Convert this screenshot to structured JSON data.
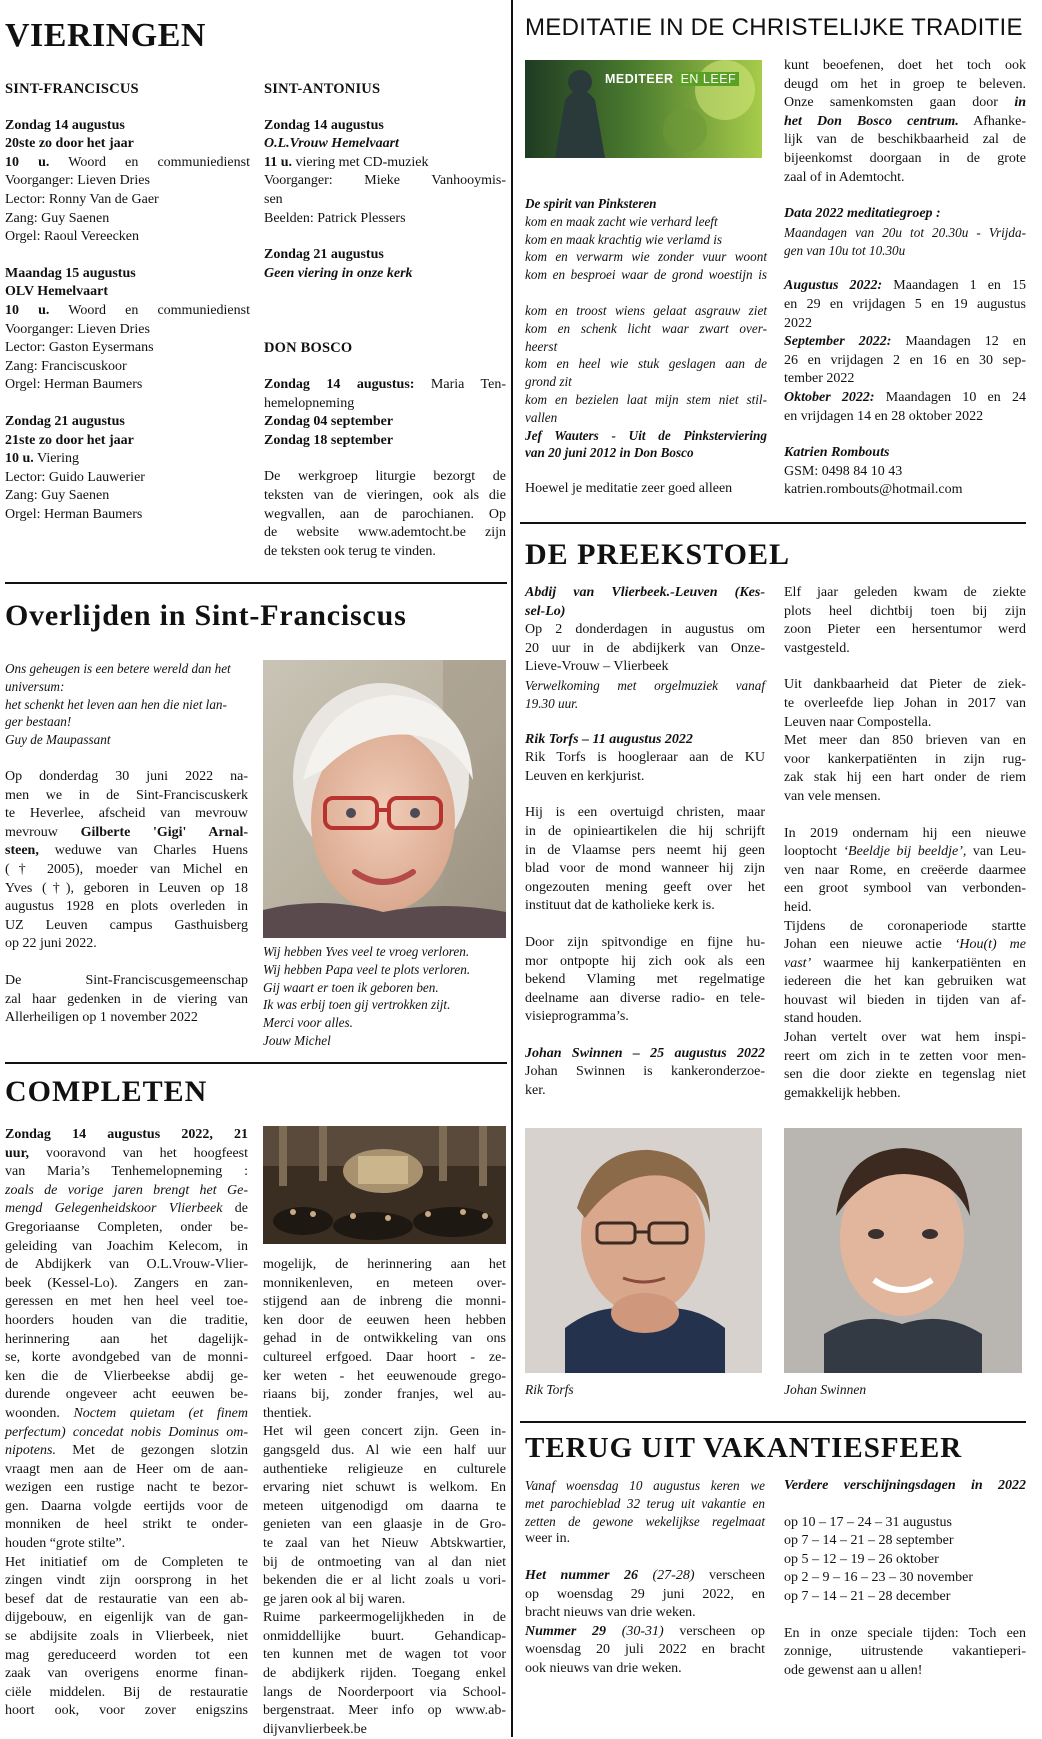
{
  "vieringen": {
    "title": "VIERINGEN",
    "franciscus": {
      "heading": "SINT-FRANCISCUS",
      "blocks": [
        {
          "l1": "Zondag 14 augustus",
          "l2": "20ste zo door het jaar",
          "l3b": "10 u.",
          "l3": " Woord en communiedienst",
          "lines": [
            "Voorganger: Lieven Dries",
            "Lector: Ronny Van de Gaer",
            "Zang: Guy Saenen",
            "Orgel: Raoul Vereecken"
          ]
        },
        {
          "l1": "Maandag 15 augustus",
          "l2": "OLV Hemelvaart",
          "l3b": "10 u.",
          "l3": " Woord en communiedienst",
          "lines": [
            "Voorganger: Lieven Dries",
            "Lector: Gaston Eysermans",
            "Zang: Franciscuskoor",
            "Orgel: Herman Baumers"
          ]
        },
        {
          "l1": "Zondag 21 augustus",
          "l2": "21ste zo door het jaar",
          "l3b": "10 u.",
          "l3": " Viering",
          "lines": [
            "Lector: Guido Lauwerier",
            "Zang: Guy Saenen",
            "Orgel: Herman Baumers"
          ]
        }
      ]
    },
    "antonius": {
      "heading": "SINT-ANTONIUS",
      "b1_l1": "Zondag 14 augustus",
      "b1_l2": "O.L.Vrouw Hemelvaart",
      "b1_l3b": "11 u.",
      "b1_l3": " viering met CD-muziek",
      "b1_voor": "Voorganger: Mieke Vanhooymis-",
      "b1_voor2": "sen",
      "b1_beeld": "Beelden: Patrick Plessers",
      "b2_l1": "Zondag 21 augustus",
      "b2_l2": "Geen viering in onze kerk"
    },
    "donbosco": {
      "heading": "DON BOSCO",
      "l1b": "Zondag 14 augustus:",
      "l1": " Maria Ten-",
      "l1b2": "hemelopneming",
      "l2": "Zondag 04 september",
      "l3": "Zondag 18 september",
      "text": [
        "De werkgroep liturgie bezorgt de",
        "teksten van de vieringen, ook als die",
        "wegvallen, aan de parochianen. Op",
        "de website www.ademtocht.be zijn",
        "de teksten ook terug te vinden."
      ]
    }
  },
  "overlijden": {
    "title": "Overlijden in Sint-Franciscus",
    "quote": [
      "Ons geheugen is een betere wereld dan het",
      "universum:",
      "het schenkt het leven aan hen die niet lan-",
      "ger bestaan!",
      "Guy de Maupassant"
    ],
    "body": [
      "Op donderdag 30 juni 2022 na-",
      "men we in de Sint-Franciscuskerk",
      "te Heverlee, afscheid van mevrouw",
      "mevrouw",
      "Gilberte 'Gigi' Arnal-",
      "steen,",
      "weduwe van Charles Huens",
      "(† 2005), moeder van Michel en",
      "Yves (†), geboren in Leuven op 18",
      "augustus 1928 en plots overleden in",
      "UZ Leuven campus Gasthuisberg",
      "op 22 juni 2022."
    ],
    "body2": [
      "De   Sint-Franciscusgemeenschap",
      "zal haar gedenken in de viering van",
      "Allerheiligen op 1 november 2022"
    ],
    "poem": [
      "Wij hebben Yves veel te vroeg verloren.",
      "Wij hebben Papa veel te plots verloren.",
      "Gij waart er toen ik geboren ben.",
      "Ik was erbij toen gij vertrokken zijt.",
      "Merci voor alles.",
      "Jouw Michel"
    ]
  },
  "completen": {
    "title": "COMPLETEN",
    "col1": [
      "Zondag 14 augustus 2022, 21",
      "uur,",
      "vooravond van het hoogfeest",
      "van Maria’s Tenhemelopneming :",
      "zoals de vorige jaren brengt het Ge-",
      "mengd Gelegenheidskoor Vlierbeek",
      "de",
      "Gregoriaanse Completen, onder be-",
      "geleiding van Joachim Kelecom, in",
      "de Abdijkerk van O.L.Vrouw-Vlier-",
      "beek (Kessel-Lo). Zangers en zan-",
      "geressen en met hen heel veel toe-",
      "hoorders houden van die traditie,",
      "herinnering aan het dagelijk-",
      "se, korte avondgebed van de monni-",
      "ken die de Vlierbeekse abdij ge-",
      "durende ongeveer acht eeuwen be-",
      "woonden.",
      "Noctem quietam (et finem",
      "perfectum) concedat nobis Dominus om-",
      "nipotens.",
      "Met de gezongen slotzin",
      "vraagt men aan de Heer om de aan-",
      "wezigen een rustige nacht te bezor-",
      "gen. Daarna volgde eertijds voor de",
      "monniken de heel strikt te onder-",
      "houden “grote stilte”.",
      "Het initiatief om de Completen te",
      "zingen vindt zijn oorsprong in het",
      "besef dat de restauratie van een ab-",
      "dijgebouw, en eigenlijk van de gan-",
      "se abdijsite zoals in Vlierbeek, niet",
      "mag gereduceerd worden tot een",
      "zaak van overigens enorme finan-",
      "ciële middelen. Bij de restauratie",
      "hoort ook, voor zover enigszins"
    ],
    "col2": [
      "mogelijk, de herinnering aan het",
      "monnikenleven, en meteen over-",
      "stijgend aan de inbreng die monni-",
      "ken door de eeuwen heen hebben",
      "gehad in de ontwikkeling van ons",
      "cultureel erfgoed. Daar hoort - ze-",
      "ker weten - het eeuwenoude grego-",
      "riaans bij, zonder franjes, wel au-",
      "thentiek.",
      "Het wil geen concert zijn. Geen in-",
      "gangsgeld dus. Al wie een half uur",
      "authentieke religieuze en culturele",
      "ervaring niet schuwt is welkom. En",
      "meteen uitgenodigd om daarna te",
      "genieten van een glaasje in de Gro-",
      "te zaal van het Nieuw Abtskwartier,",
      "bij de ontmoeting van al dan niet",
      "bekenden die er al licht zoals u vori-",
      "ge jaren ook al bij waren.",
      "Ruime parkeermogelijkheden in de",
      "onmiddellijke buurt. Gehandicap-",
      "ten kunnen met de wagen tot voor",
      "de abdijkerk rijden. Toegang enkel",
      "langs de Noorderpoort via School-",
      "bergenstraat. Meer info op www.ab-",
      "dijvanvlierbeek.be"
    ]
  },
  "meditatie": {
    "title": "MEDITATIE IN DE CHRISTELIJKE TRADITIE",
    "banner1": "MEDITEER",
    "banner2": "EN LEEF",
    "poem_title": "De spirit van Pinksteren",
    "poem": [
      "kom en maak zacht wie verhard leeft",
      "kom en maak krachtig wie verlamd is",
      "kom en verwarm wie zonder vuur woont",
      "kom en besproei waar de grond woestijn is",
      "",
      "kom en troost wiens gelaat asgrauw ziet",
      "kom en schenk licht waar zwart over-",
      "heerst",
      "kom en heel wie stuk geslagen aan de",
      "grond zit",
      "kom en bezielen laat mijn stem niet stil-",
      "vallen"
    ],
    "poem_src1": "Jef Wauters - Uit de Pinksterviering",
    "poem_src2": "van 20 juni 2012 in Don Bosco",
    "tail": "Hoewel je meditatie zeer goed alleen",
    "right": [
      "kunt beoefenen, doet het toch ook",
      "deugd om het in groep te beleven.",
      "Onze samenkomsten gaan door",
      "in",
      "het Don Bosco centrum.",
      "Afhanke-",
      "lijk van de beschikbaarheid zal de",
      "bijeenkomst doorgaan in de grote",
      "zaal of in Ademtocht."
    ],
    "data_title": "Data 2022 meditatiegroep :",
    "data_sub1": "Maandagen van 20u tot 20.30u - Vrijda-",
    "data_sub2": "gen van 10u tot 10.30u",
    "aug_b": "Augustus 2022:",
    "aug": [
      " Maandagen 1 en 15",
      "en 29 en vrijdagen 5 en 19 augustus",
      "2022"
    ],
    "sep_b": "September 2022:",
    "sep": [
      " Maandagen 12 en",
      "26 en vrijdagen 2 en 16 en 30 sep-",
      "tember 2022"
    ],
    "okt_b": "Oktober 2022:",
    "okt": [
      " Maandagen 10 en 24",
      "en vrijdagen 14 en 28 oktober 2022"
    ],
    "contact_name": "Katrien Rombouts",
    "contact_gsm": "GSM: 0498 84 10 43",
    "contact_mail": "katrien.rombouts@hotmail.com"
  },
  "preekstoel": {
    "title": "DE PREEKSTOEL",
    "left": {
      "h1a": "Abdij van Vlierbeek.-Leuven (Kes-",
      "h1b": "sel-Lo)",
      "p1": [
        "Op 2 donderdagen in augustus om",
        "20 uur in de abdijkerk van Onze-",
        "Lieve-Vrouw – Vlierbeek"
      ],
      "p1i": [
        "Verwelkoming met orgelmuziek vanaf",
        "19.30 uur."
      ],
      "h2": "Rik Torfs – 11 augustus 2022",
      "p2": [
        "Rik Torfs is hoogleraar aan de KU",
        "Leuven en kerkjurist."
      ],
      "p3": [
        "Hij is een overtuigd christen, maar",
        "in de opinieartikelen die hij schrijft",
        "in de Vlaamse pers neemt hij geen",
        "blad voor de mond wanneer hij zijn",
        "ongezouten mening geeft over het",
        "instituut dat de katholieke kerk is."
      ],
      "p4": [
        "Door zijn spitvondige en fijne hu-",
        "mor ontpopte hij zich ook als een",
        "bekend Vlaming met regelmatige",
        "deelname aan diverse radio- en tele-",
        "visieprogramma’s."
      ],
      "h3": "Johan Swinnen – 25 augustus 2022",
      "p5": [
        "Johan Swinnen is kankeronderzoe-",
        "ker."
      ]
    },
    "right": {
      "p1": [
        "Elf jaar geleden kwam de ziekte",
        "plots heel dichtbij toen bij zijn",
        "zoon Pieter een hersentumor werd",
        "vastgesteld."
      ],
      "p2": [
        "Uit dankbaarheid dat Pieter de ziek-",
        "te overleefde liep Johan in 2017 van",
        "Leuven naar Compostella.",
        "Met meer dan 850 brieven van en",
        "voor kankerpatiënten in zijn rug-",
        "zak stak hij een hart onder de riem",
        "van vele mensen."
      ],
      "p3": [
        "In 2019 ondernam hij een nieuwe",
        "looptocht",
        "‘Beeldje bij beeldje’,",
        "van Leu-",
        "ven naar Rome, en creëerde daarmee",
        "een groot symbool van verbonden-",
        "heid.",
        "Tijdens de coronaperiode startte",
        "Johan een nieuwe actie",
        "‘Hou(t) me",
        "vast’",
        "waarmee hij kankerpatiënten en",
        "iedereen die het kan gebruiken wat",
        "houvast wil bieden in tijden van af-",
        "stand houden.",
        "Johan vertelt over wat hem inspi-",
        "reert om zich in te zetten voor men-",
        "sen die door ziekte en tegenslag niet",
        "gemakkelijk hebben."
      ]
    },
    "cap1": "Rik Torfs",
    "cap2": "Johan Swinnen"
  },
  "terug": {
    "title": "TERUG UIT VAKANTIESFEER",
    "intro": [
      "Vanaf woensdag 10 augustus keren we",
      "met parochieblad 32 terug uit vakantie en",
      "zetten de gewone wekelijkse regelmaat",
      "weer in."
    ],
    "n26a": "Het nummer 26",
    "n26b": " (27-28)",
    "n26": [
      " verscheen",
      "op woensdag 29 juni 2022, en",
      "bracht nieuws van drie weken."
    ],
    "n29a": "Nummer 29",
    "n29b": " (30-31)",
    "n29": [
      " verscheen op",
      "woensdag 20 juli 2022 en bracht",
      "ook nieuws van drie weken."
    ],
    "dates_title": "Verdere verschijningsdagen in 2022",
    "dates": [
      "op 10 – 17 – 24 – 31 augustus",
      "op 7 – 14 – 21 – 28 september",
      "op 5 – 12 – 19 – 26 oktober",
      "op 2 – 9 – 16 – 23 – 30 november",
      "op 7 – 14 – 21 – 28 december"
    ],
    "closing": [
      "En in onze speciale tijden: Toch een",
      "zonnige, uitrustende vakantieperi-",
      "ode gewenst aan u allen!"
    ]
  }
}
